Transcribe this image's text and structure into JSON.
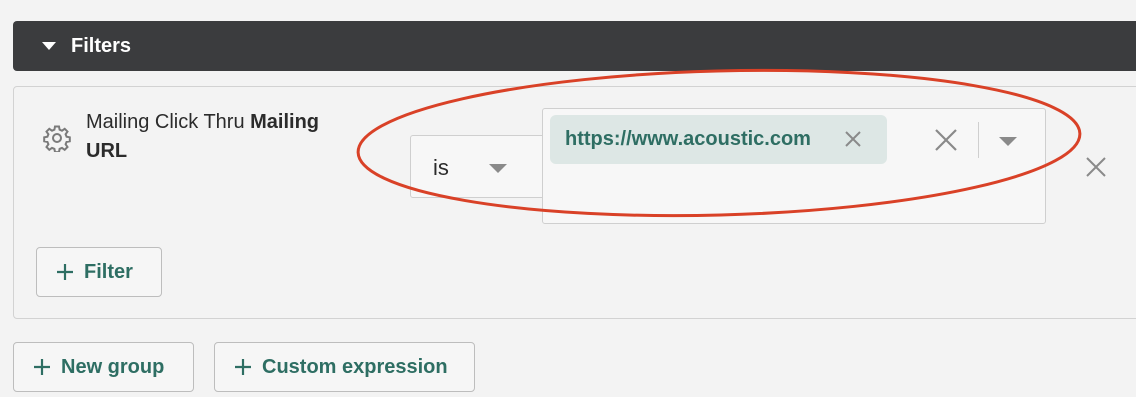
{
  "filters_header": {
    "title": "Filters"
  },
  "filter_row": {
    "label_prefix": "Mailing Click Thru",
    "label_bold": "Mailing URL",
    "operator": "is",
    "chip_value": "https://www.acoustic.com"
  },
  "buttons": {
    "add_filter": "Filter",
    "new_group": "New group",
    "custom_expression": "Custom expression"
  },
  "colors": {
    "header_bg": "#3b3c3e",
    "accent_green": "#2e6e63",
    "chip_bg": "#dde7e5",
    "annotation_red": "#d94127"
  },
  "icons": [
    "caret-down-icon",
    "gear-icon",
    "close-icon",
    "chevron-down-icon",
    "plus-icon"
  ]
}
